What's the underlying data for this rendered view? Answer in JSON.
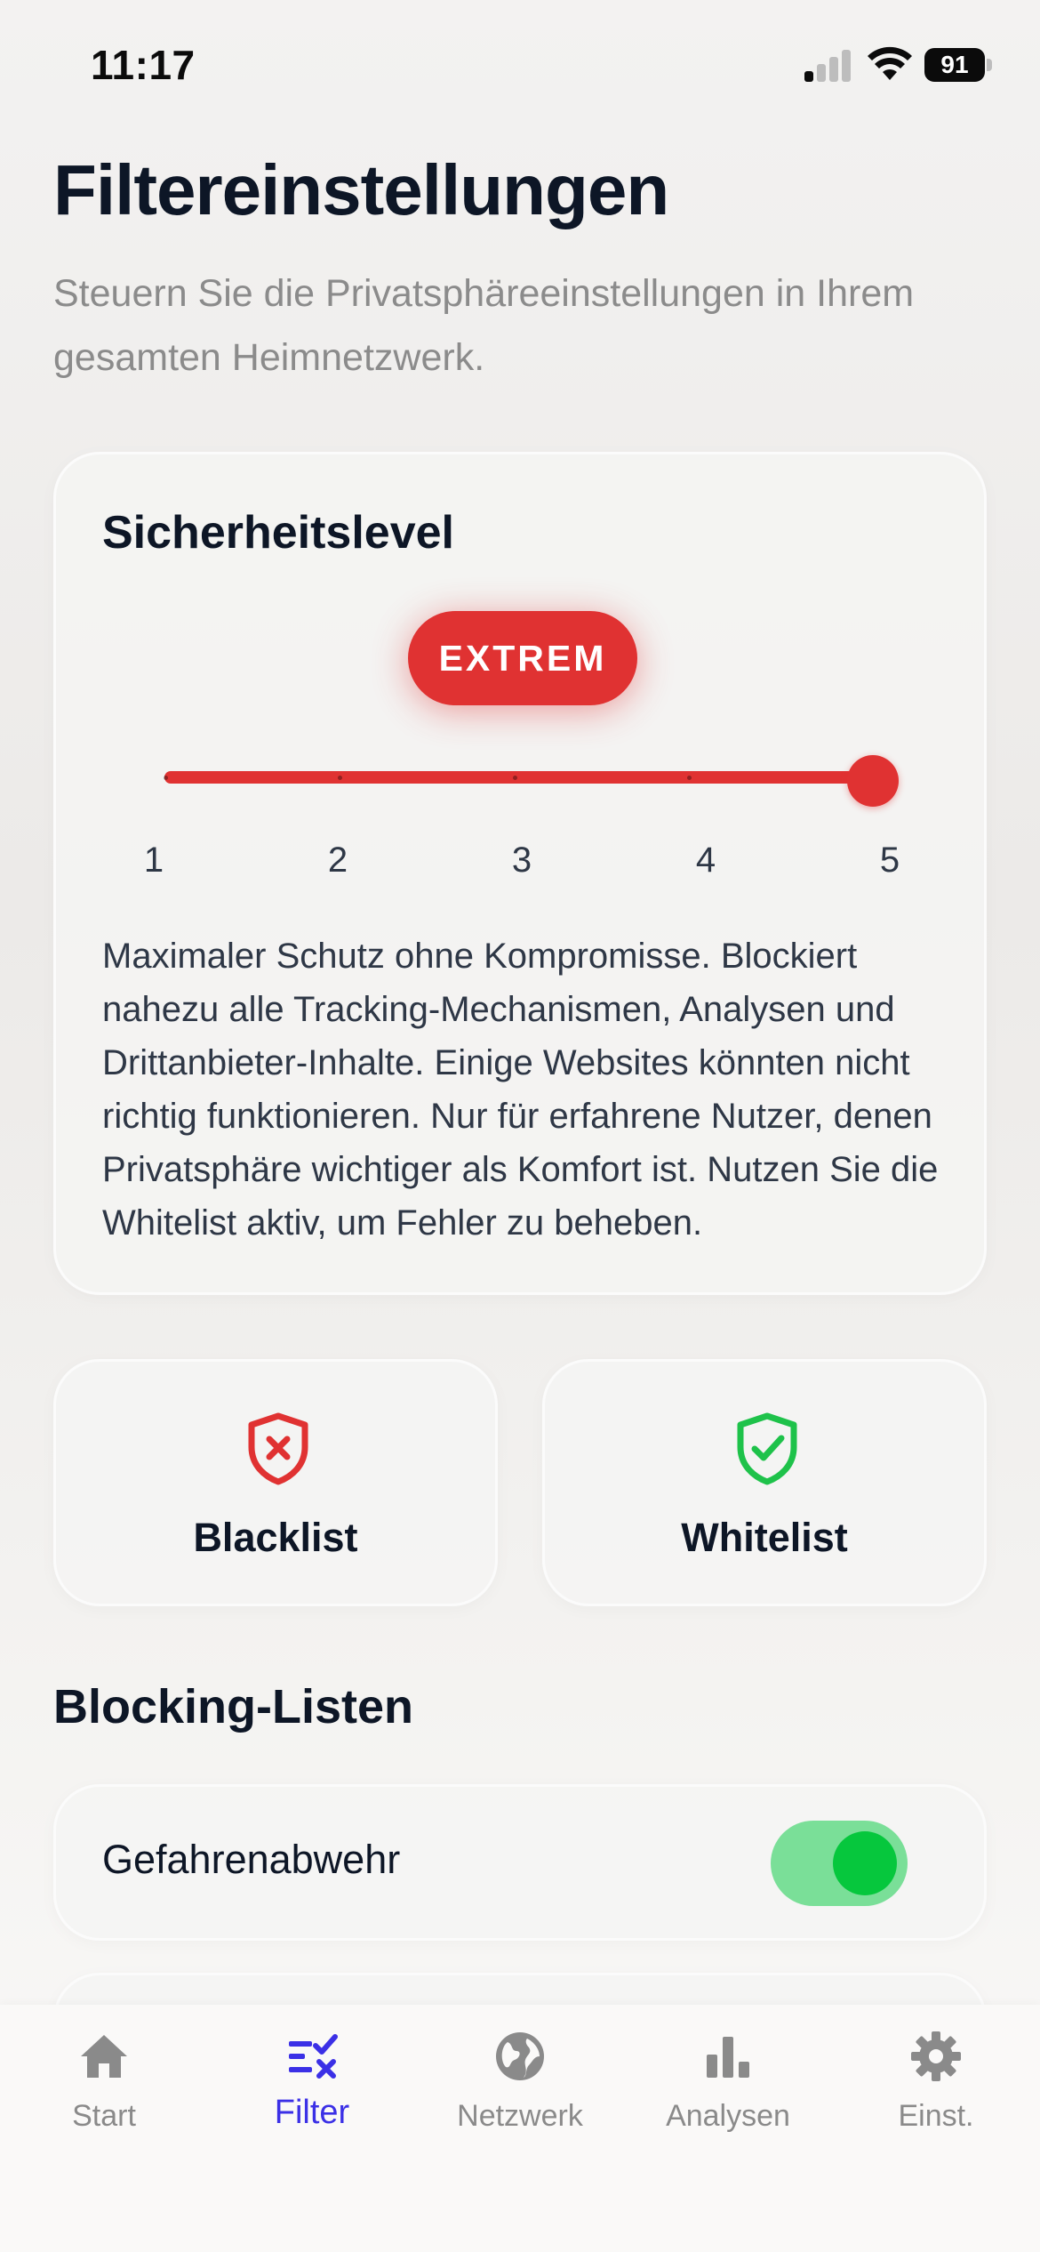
{
  "status_bar": {
    "time": "11:17",
    "battery": "91"
  },
  "header": {
    "title": "Filtereinstellungen",
    "subtitle": "Steuern Sie die Privatsphäreeinstellungen in Ihrem gesamten Heimnetzwerk."
  },
  "security": {
    "label": "Sicherheitslevel",
    "level_name": "EXTREM",
    "level_value": 5,
    "level_min": 1,
    "level_max": 5,
    "ticks": [
      "1",
      "2",
      "3",
      "4",
      "5"
    ],
    "description": "Maximaler Schutz ohne Kompromisse. Blockiert nahezu alle Tracking-Mechanismen, Analysen und Drittanbieter-Inhalte. Einige Websites könnten nicht richtig funktionieren. Nur für erfahrene Nutzer, denen Privatsphäre wichtiger als Komfort ist. Nutzen Sie die Whitelist aktiv, um Fehler zu beheben.",
    "accent_color": "#e03232"
  },
  "lists": {
    "blacklist": {
      "label": "Blacklist",
      "icon": "shield-x-icon",
      "color": "#e03232"
    },
    "whitelist": {
      "label": "Whitelist",
      "icon": "shield-check-icon",
      "color": "#1ec24a"
    }
  },
  "blocking": {
    "title": "Blocking-Listen",
    "items": [
      {
        "label": "Gefahrenabwehr",
        "enabled": true
      }
    ]
  },
  "tabs": [
    {
      "label": "Start",
      "icon": "home-icon",
      "active": false
    },
    {
      "label": "Filter",
      "icon": "filter-icon",
      "active": true
    },
    {
      "label": "Netzwerk",
      "icon": "globe-icon",
      "active": false
    },
    {
      "label": "Analysen",
      "icon": "bar-chart-icon",
      "active": false
    },
    {
      "label": "Einst.",
      "icon": "gear-icon",
      "active": false
    }
  ],
  "colors": {
    "active_tab": "#3b30e6",
    "inactive_tab": "#8a8a8a",
    "toggle_on": "#06c73d"
  }
}
